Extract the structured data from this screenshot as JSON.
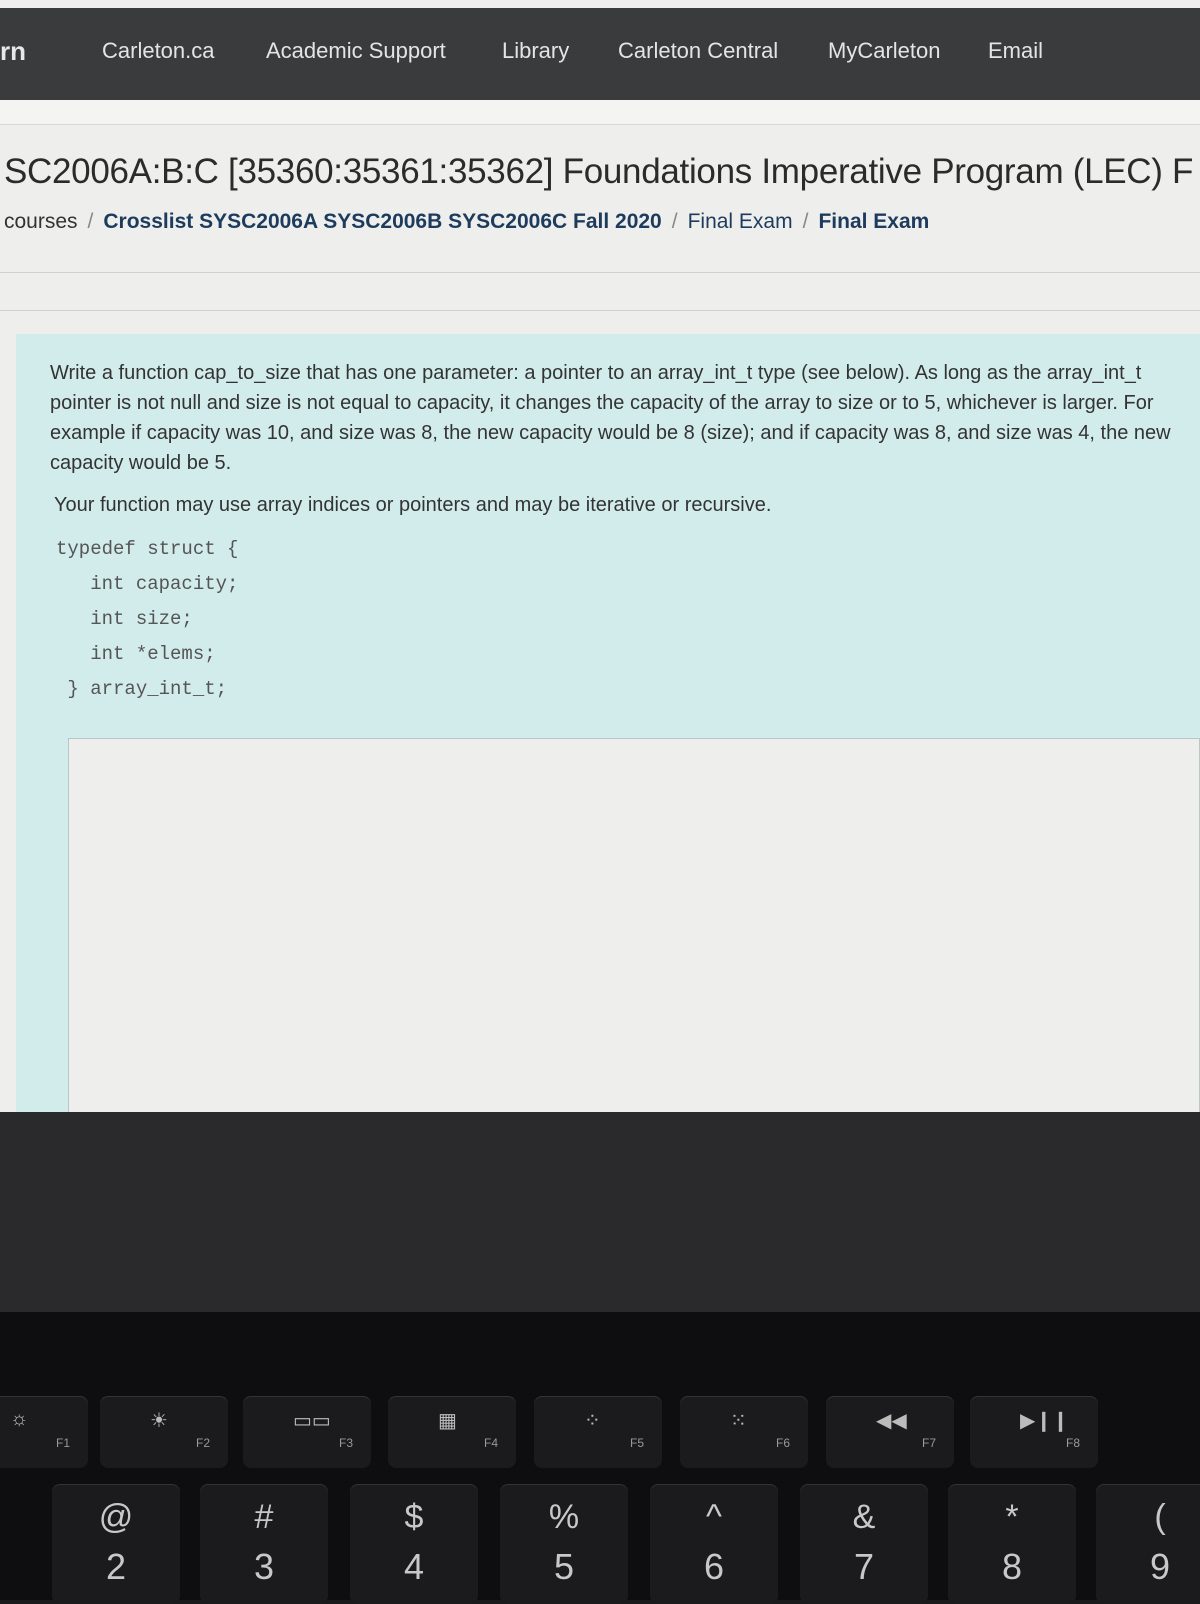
{
  "nav": {
    "brand": "rn",
    "links": [
      "Carleton.ca",
      "Academic Support",
      "Library",
      "Carleton Central",
      "MyCarleton",
      "Email"
    ]
  },
  "page": {
    "title": "SC2006A:B:C [35360:35361:35362] Foundations Imperative Program (LEC) F",
    "breadcrumbs": [
      "courses",
      "Crosslist SYSC2006A SYSC2006B SYSC2006C Fall 2020",
      "Final Exam",
      "Final Exam"
    ]
  },
  "question": {
    "p1": "Write a function cap_to_size that has one parameter: a pointer to an array_int_t type (see below). As long as the array_int_t pointer is not null and size is not equal to capacity, it changes the capacity of the array to size or to 5, whichever is larger. For example if capacity was 10, and size was 8, the new capacity would be 8 (size); and if capacity was 8, and size was 4, the new capacity would be 5.",
    "p2": "Your function may use array indices or pointers and may be iterative or recursive.",
    "code": "typedef struct {\n   int capacity;\n   int size;\n   int *elems;\n } array_int_t;",
    "answer_value": ""
  },
  "keyboard": {
    "fkeys": [
      {
        "icon": "brightness-down-icon",
        "glyph": "☼",
        "label": "F1"
      },
      {
        "icon": "brightness-up-icon",
        "glyph": "☀",
        "label": "F2"
      },
      {
        "icon": "mission-control-icon",
        "glyph": "▭▭",
        "label": "F3"
      },
      {
        "icon": "launchpad-icon",
        "glyph": "▦",
        "label": "F4"
      },
      {
        "icon": "keyboard-light-down-icon",
        "glyph": "⁘",
        "label": "F5"
      },
      {
        "icon": "keyboard-light-up-icon",
        "glyph": "⁙",
        "label": "F6"
      },
      {
        "icon": "rewind-icon",
        "glyph": "◀◀",
        "label": "F7"
      },
      {
        "icon": "play-pause-icon",
        "glyph": "▶❙❙",
        "label": "F8"
      }
    ],
    "numkeys": [
      {
        "top": "@",
        "bottom": "2"
      },
      {
        "top": "#",
        "bottom": "3"
      },
      {
        "top": "$",
        "bottom": "4"
      },
      {
        "top": "%",
        "bottom": "5"
      },
      {
        "top": "^",
        "bottom": "6"
      },
      {
        "top": "&",
        "bottom": "7"
      },
      {
        "top": "*",
        "bottom": "8"
      },
      {
        "top": "(",
        "bottom": "9"
      }
    ]
  }
}
